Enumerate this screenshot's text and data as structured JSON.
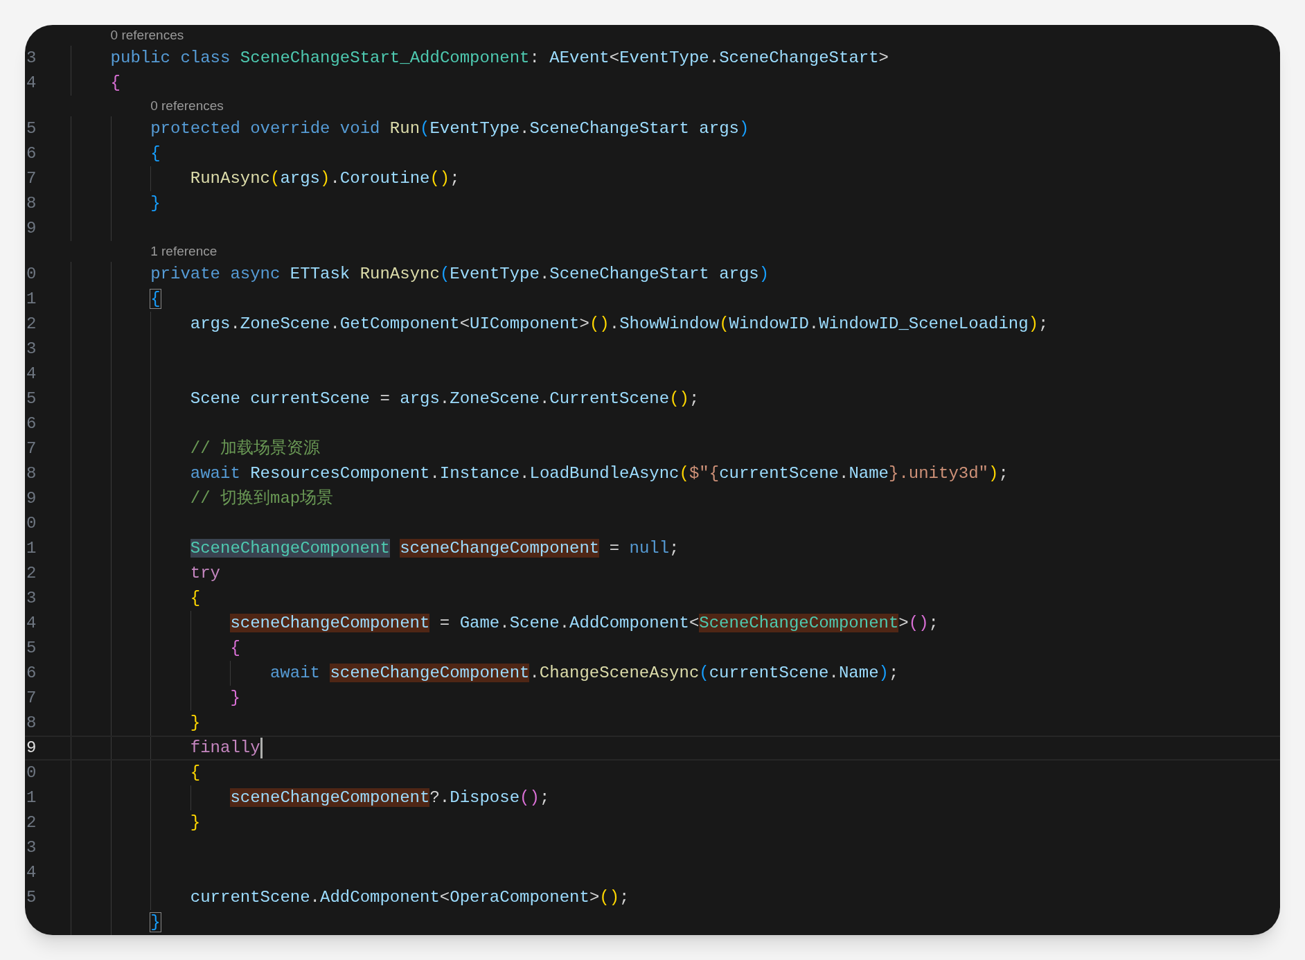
{
  "lines": [
    {
      "kind": "codelens",
      "text": "0 references"
    },
    {
      "kind": "code",
      "number": "3",
      "current": false,
      "tokens": [
        {
          "t": "public class ",
          "kind": "kw"
        },
        {
          "t": "SceneChangeStart_AddComponent",
          "kind": "type"
        },
        {
          "t": ": ",
          "kind": "p"
        },
        {
          "t": "AEvent",
          "kind": "id"
        },
        {
          "t": "<",
          "kind": "p"
        },
        {
          "t": "EventType",
          "kind": "id"
        },
        {
          "t": ".",
          "kind": "p"
        },
        {
          "t": "SceneChangeStart",
          "kind": "id"
        },
        {
          "t": ">",
          "kind": "p"
        }
      ]
    },
    {
      "kind": "code",
      "number": "4",
      "current": false,
      "tokens": [
        {
          "t": "{",
          "kind": "b2"
        }
      ],
      "children": [
        {
          "kind": "codelens",
          "text": "0 references"
        },
        {
          "kind": "code",
          "number": "5",
          "current": false,
          "tokens": [
            {
              "t": "protected override void ",
              "kind": "kw"
            },
            {
              "t": "Run",
              "kind": "fn"
            },
            {
              "t": "(",
              "kind": "b3"
            },
            {
              "t": "EventType",
              "kind": "id"
            },
            {
              "t": ".",
              "kind": "p"
            },
            {
              "t": "SceneChangeStart args",
              "kind": "id"
            },
            {
              "t": ")",
              "kind": "b3"
            }
          ]
        },
        {
          "kind": "code",
          "number": "6",
          "current": false,
          "tokens": [
            {
              "t": "{",
              "kind": "b3"
            }
          ],
          "children": [
            {
              "kind": "code",
              "number": "7",
              "current": false,
              "tokens": [
                {
                  "t": "RunAsync",
                  "kind": "fn"
                },
                {
                  "t": "(",
                  "kind": "b1"
                },
                {
                  "t": "args",
                  "kind": "id"
                },
                {
                  "t": ")",
                  "kind": "b1"
                },
                {
                  "t": ".",
                  "kind": "p"
                },
                {
                  "t": "Coroutine",
                  "kind": "id"
                },
                {
                  "t": "()",
                  "kind": "b1"
                },
                {
                  "t": ";",
                  "kind": "p"
                }
              ]
            }
          ]
        },
        {
          "kind": "code",
          "number": "8",
          "current": false,
          "tokens": [
            {
              "t": "}",
              "kind": "b3"
            }
          ]
        },
        {
          "kind": "code",
          "number": "9",
          "current": false
        },
        {
          "kind": "codelens",
          "text": "1 reference"
        },
        {
          "kind": "code",
          "number": "0",
          "current": false,
          "tokens": [
            {
              "t": "private async ",
              "kind": "kw"
            },
            {
              "t": "ETTask ",
              "kind": "id"
            },
            {
              "t": "RunAsync",
              "kind": "fn"
            },
            {
              "t": "(",
              "kind": "b3"
            },
            {
              "t": "EventType",
              "kind": "id"
            },
            {
              "t": ".",
              "kind": "p"
            },
            {
              "t": "SceneChangeStart args",
              "kind": "id"
            },
            {
              "t": ")",
              "kind": "b3"
            }
          ]
        },
        {
          "kind": "code",
          "number": "1",
          "current": false,
          "tokens": [
            {
              "t": "{",
              "kind": "b3",
              "matched": true
            }
          ],
          "children": [
            {
              "kind": "code",
              "number": "2",
              "current": false,
              "tokens": [
                {
                  "t": "args",
                  "kind": "id"
                },
                {
                  "t": ".",
                  "kind": "p"
                },
                {
                  "t": "ZoneScene",
                  "kind": "id"
                },
                {
                  "t": ".",
                  "kind": "p"
                },
                {
                  "t": "GetComponent",
                  "kind": "id"
                },
                {
                  "t": "<",
                  "kind": "p"
                },
                {
                  "t": "UIComponent",
                  "kind": "id"
                },
                {
                  "t": ">",
                  "kind": "p"
                },
                {
                  "t": "()",
                  "kind": "b1"
                },
                {
                  "t": ".",
                  "kind": "p"
                },
                {
                  "t": "ShowWindow",
                  "kind": "id"
                },
                {
                  "t": "(",
                  "kind": "b1"
                },
                {
                  "t": "WindowID",
                  "kind": "id"
                },
                {
                  "t": ".",
                  "kind": "p"
                },
                {
                  "t": "WindowID_SceneLoading",
                  "kind": "id"
                },
                {
                  "t": ")",
                  "kind": "b1"
                },
                {
                  "t": ";",
                  "kind": "p"
                }
              ]
            },
            {
              "kind": "code",
              "number": "3",
              "current": false
            },
            {
              "kind": "code",
              "number": "4",
              "current": false
            },
            {
              "kind": "code",
              "number": "5",
              "current": false,
              "tokens": [
                {
                  "t": "Scene currentScene",
                  "kind": "id"
                },
                {
                  "t": " = ",
                  "kind": "p"
                },
                {
                  "t": "args",
                  "kind": "id"
                },
                {
                  "t": ".",
                  "kind": "p"
                },
                {
                  "t": "ZoneScene",
                  "kind": "id"
                },
                {
                  "t": ".",
                  "kind": "p"
                },
                {
                  "t": "CurrentScene",
                  "kind": "id"
                },
                {
                  "t": "()",
                  "kind": "b1"
                },
                {
                  "t": ";",
                  "kind": "p"
                }
              ]
            },
            {
              "kind": "code",
              "number": "6",
              "current": false
            },
            {
              "kind": "code",
              "number": "7",
              "current": false,
              "tokens": [
                {
                  "t": "// 加载场景资源",
                  "kind": "comment"
                }
              ]
            },
            {
              "kind": "code",
              "number": "8",
              "current": false,
              "tokens": [
                {
                  "t": "await ",
                  "kind": "kw"
                },
                {
                  "t": "ResourcesComponent",
                  "kind": "id"
                },
                {
                  "t": ".",
                  "kind": "p"
                },
                {
                  "t": "Instance",
                  "kind": "id"
                },
                {
                  "t": ".",
                  "kind": "p"
                },
                {
                  "t": "LoadBundleAsync",
                  "kind": "id"
                },
                {
                  "t": "(",
                  "kind": "b1"
                },
                {
                  "t": "$\"{",
                  "kind": "str"
                },
                {
                  "t": "currentScene",
                  "kind": "id"
                },
                {
                  "t": ".",
                  "kind": "p"
                },
                {
                  "t": "Name",
                  "kind": "id"
                },
                {
                  "t": "}.unity3d\"",
                  "kind": "str"
                },
                {
                  "t": ")",
                  "kind": "b1"
                },
                {
                  "t": ";",
                  "kind": "p"
                }
              ]
            },
            {
              "kind": "code",
              "number": "9",
              "current": false,
              "tokens": [
                {
                  "t": "// 切换到map场景",
                  "kind": "comment"
                }
              ]
            },
            {
              "kind": "code",
              "number": "0",
              "current": false
            },
            {
              "kind": "code",
              "number": "1",
              "current": false,
              "tokens": [
                {
                  "t": "SceneChangeComponent",
                  "kind": "type",
                  "selected": true,
                  "space_after": true
                },
                {
                  "t": "sceneChangeComponent",
                  "kind": "id",
                  "referenced": true
                },
                {
                  "t": " = ",
                  "kind": "p"
                },
                {
                  "t": "null",
                  "kind": "kw"
                },
                {
                  "t": ";",
                  "kind": "p"
                }
              ]
            },
            {
              "kind": "code",
              "number": "2",
              "current": false,
              "tokens": [
                {
                  "t": "try",
                  "kind": "ctl"
                }
              ]
            },
            {
              "kind": "code",
              "number": "3",
              "current": false,
              "tokens": [
                {
                  "t": "{",
                  "kind": "b1"
                }
              ],
              "children": [
                {
                  "kind": "code",
                  "number": "4",
                  "current": false,
                  "tokens": [
                    {
                      "t": "sceneChangeComponent",
                      "kind": "id",
                      "referenced": true
                    },
                    {
                      "t": " = ",
                      "kind": "p"
                    },
                    {
                      "t": "Game",
                      "kind": "id"
                    },
                    {
                      "t": ".",
                      "kind": "p"
                    },
                    {
                      "t": "Scene",
                      "kind": "id"
                    },
                    {
                      "t": ".",
                      "kind": "p"
                    },
                    {
                      "t": "AddComponent",
                      "kind": "id"
                    },
                    {
                      "t": "<",
                      "kind": "p"
                    },
                    {
                      "t": "SceneChangeComponent",
                      "kind": "type",
                      "referenced": true
                    },
                    {
                      "t": ">",
                      "kind": "p"
                    },
                    {
                      "t": "()",
                      "kind": "b2"
                    },
                    {
                      "t": ";",
                      "kind": "p"
                    }
                  ]
                },
                {
                  "kind": "code",
                  "number": "5",
                  "current": false,
                  "tokens": [
                    {
                      "t": "{",
                      "kind": "b2"
                    }
                  ],
                  "children": [
                    {
                      "kind": "code",
                      "number": "6",
                      "current": false,
                      "tokens": [
                        {
                          "t": "await ",
                          "kind": "kw"
                        },
                        {
                          "t": "sceneChangeComponent",
                          "kind": "id",
                          "referenced": true
                        },
                        {
                          "t": ".",
                          "kind": "p"
                        },
                        {
                          "t": "ChangeSceneAsync",
                          "kind": "fn"
                        },
                        {
                          "t": "(",
                          "kind": "b3"
                        },
                        {
                          "t": "currentScene",
                          "kind": "id"
                        },
                        {
                          "t": ".",
                          "kind": "p"
                        },
                        {
                          "t": "Name",
                          "kind": "id"
                        },
                        {
                          "t": ")",
                          "kind": "b3"
                        },
                        {
                          "t": ";",
                          "kind": "p"
                        }
                      ]
                    }
                  ]
                },
                {
                  "kind": "code",
                  "number": "7",
                  "current": false,
                  "tokens": [
                    {
                      "t": "}",
                      "kind": "b2"
                    }
                  ]
                }
              ]
            },
            {
              "kind": "code",
              "number": "8",
              "current": false,
              "tokens": [
                {
                  "t": "}",
                  "kind": "b1"
                }
              ]
            },
            {
              "kind": "code",
              "number": "9",
              "current": true,
              "tokens": [
                {
                  "t": "finally",
                  "kind": "ctl"
                }
              ]
            },
            {
              "kind": "code",
              "number": "0",
              "current": false,
              "tokens": [
                {
                  "t": "{",
                  "kind": "b1"
                }
              ],
              "children": [
                {
                  "kind": "code",
                  "number": "1",
                  "current": false,
                  "tokens": [
                    {
                      "t": "sceneChangeComponent",
                      "kind": "id",
                      "referenced": true
                    },
                    {
                      "t": "?.",
                      "kind": "p"
                    },
                    {
                      "t": "Dispose",
                      "kind": "id"
                    },
                    {
                      "t": "()",
                      "kind": "b2"
                    },
                    {
                      "t": ";",
                      "kind": "p"
                    }
                  ]
                }
              ]
            },
            {
              "kind": "code",
              "number": "2",
              "current": false,
              "tokens": [
                {
                  "t": "}",
                  "kind": "b1"
                }
              ]
            },
            {
              "kind": "code",
              "number": "3",
              "current": false
            },
            {
              "kind": "code",
              "number": "4",
              "current": false
            },
            {
              "kind": "code",
              "number": "5",
              "current": false,
              "tokens": [
                {
                  "t": "currentScene",
                  "kind": "id"
                },
                {
                  "t": ".",
                  "kind": "p"
                },
                {
                  "t": "AddComponent",
                  "kind": "id"
                },
                {
                  "t": "<",
                  "kind": "p"
                },
                {
                  "t": "OperaComponent",
                  "kind": "id"
                },
                {
                  "t": ">",
                  "kind": "p"
                },
                {
                  "t": "()",
                  "kind": "b1"
                },
                {
                  "t": ";",
                  "kind": "p"
                }
              ]
            }
          ]
        },
        {
          "kind": "code",
          "current": false,
          "tokens": [
            {
              "t": "}",
              "kind": "b3",
              "matched": true
            }
          ]
        }
      ]
    }
  ]
}
